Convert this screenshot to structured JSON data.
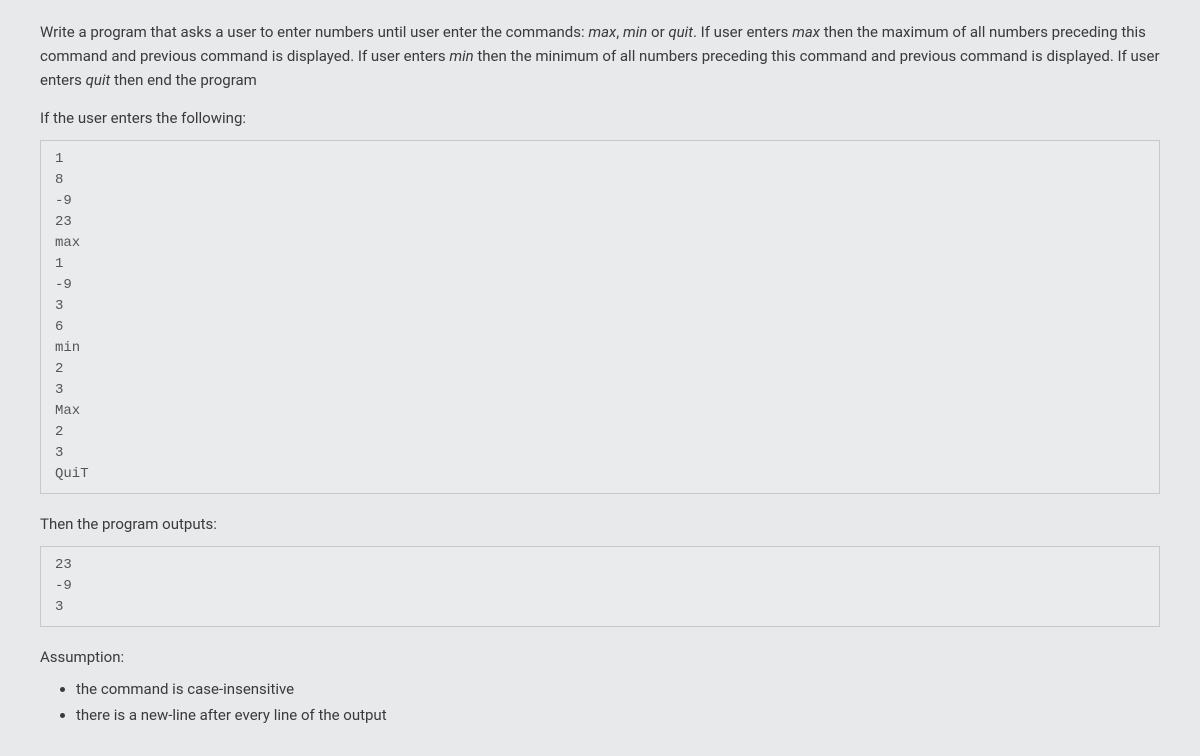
{
  "description": {
    "text_before_max": "Write a program that asks a user to enter numbers until user enter the commands: ",
    "max": "max",
    "sep1": ", ",
    "min": "min",
    "sep2": " or ",
    "quit": "quit",
    "after_quit": ". If user enters ",
    "max2": "max",
    "after_max2": " then the maximum of all numbers preceding this command and previous command is displayed. If user enters ",
    "min2": "min",
    "after_min2": " then the minimum of all numbers preceding this command and previous command is displayed. If user enters ",
    "quit2": "quit",
    "after_quit2": " then end the program"
  },
  "if_user_enters": "If the user enters the following:",
  "input_block": "1\n8\n-9\n23\nmax\n1\n-9\n3\n6\nmin\n2\n3\nMax\n2\n3\nQuiT",
  "then_outputs": "Then the program outputs:",
  "output_block": "23\n-9\n3",
  "assumption_label": "Assumption:",
  "assumptions": [
    "the command is case-insensitive",
    "there is a new-line after every line of the output"
  ]
}
